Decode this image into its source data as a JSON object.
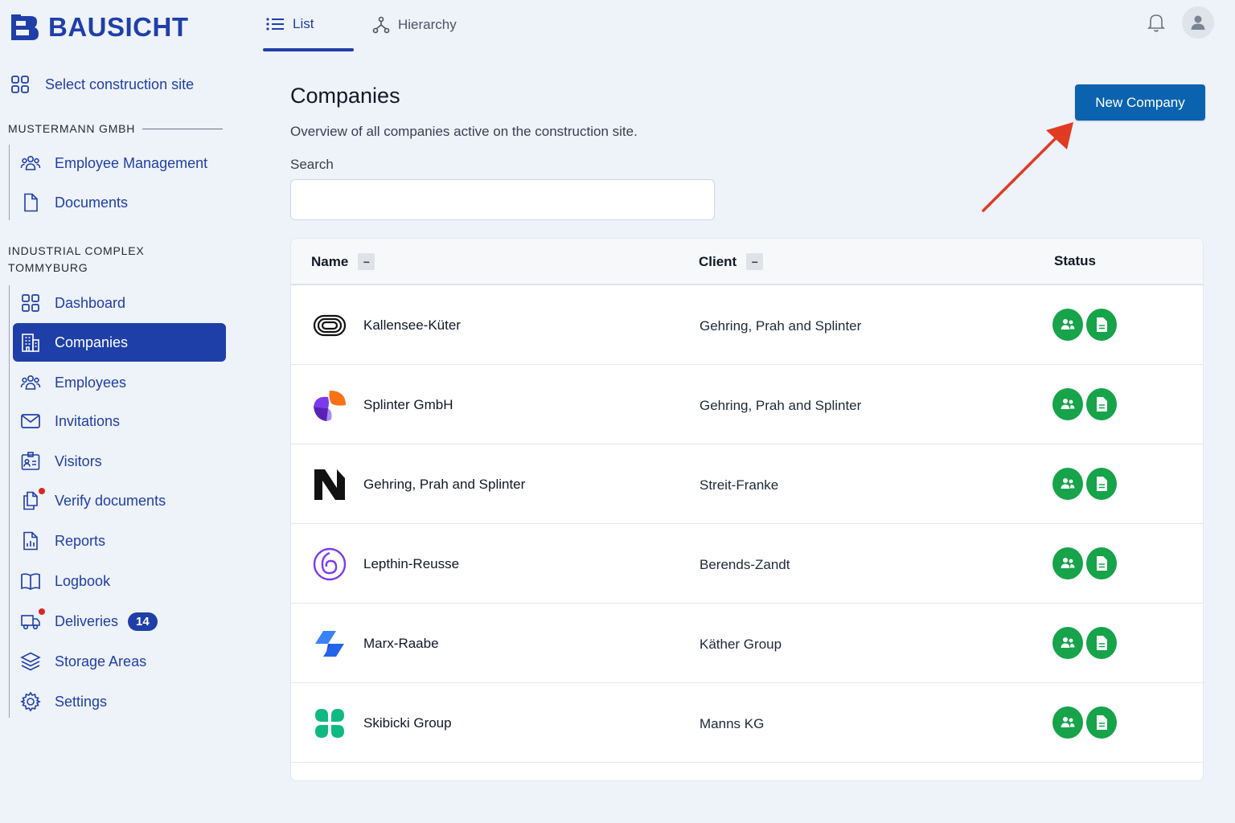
{
  "app": {
    "name": "BAUSICHT"
  },
  "tabs": [
    {
      "label": "List",
      "icon": "list-icon",
      "active": true
    },
    {
      "label": "Hierarchy",
      "icon": "hierarchy-icon",
      "active": false
    }
  ],
  "sidebar": {
    "select_site": "Select construction site",
    "org_section": "MUSTERMANN GMBH",
    "org_items": [
      {
        "label": "Employee Management",
        "icon": "users-icon"
      },
      {
        "label": "Documents",
        "icon": "document-icon"
      }
    ],
    "site_section_line1": "INDUSTRIAL COMPLEX",
    "site_section_line2": "TOMMYBURG",
    "site_items": [
      {
        "label": "Dashboard",
        "icon": "grid-icon"
      },
      {
        "label": "Companies",
        "icon": "building-icon",
        "active": true
      },
      {
        "label": "Employees",
        "icon": "users-icon"
      },
      {
        "label": "Invitations",
        "icon": "envelope-icon"
      },
      {
        "label": "Visitors",
        "icon": "visitor-card-icon"
      },
      {
        "label": "Verify documents",
        "icon": "documents-copy-icon",
        "alert": true
      },
      {
        "label": "Reports",
        "icon": "report-icon"
      },
      {
        "label": "Logbook",
        "icon": "book-icon"
      },
      {
        "label": "Deliveries",
        "icon": "truck-icon",
        "alert": true,
        "badge": "14"
      },
      {
        "label": "Storage Areas",
        "icon": "layers-icon"
      },
      {
        "label": "Settings",
        "icon": "gear-icon"
      }
    ]
  },
  "main": {
    "title": "Companies",
    "subtitle": "Overview of all companies active on the construction site.",
    "search_label": "Search",
    "search_value": "",
    "new_button": "New Company"
  },
  "table": {
    "headers": {
      "name": "Name",
      "client": "Client",
      "status": "Status"
    },
    "sort_symbol": "−",
    "rows": [
      {
        "name": "Kallensee-Küter",
        "client": "Gehring, Prah and Splinter",
        "logo": "rings-logo"
      },
      {
        "name": "Splinter GmbH",
        "client": "Gehring, Prah and Splinter",
        "logo": "petals-logo"
      },
      {
        "name": "Gehring, Prah and Splinter",
        "client": "Streit-Franke",
        "logo": "n-logo"
      },
      {
        "name": "Lepthin-Reusse",
        "client": "Berends-Zandt",
        "logo": "spiral-logo"
      },
      {
        "name": "Marx-Raabe",
        "client": "Käther Group",
        "logo": "slash-logo"
      },
      {
        "name": "Skibicki Group",
        "client": "Manns KG",
        "logo": "clover-logo"
      }
    ]
  },
  "colors": {
    "brand": "#1f3fa8",
    "button": "#0b63b0",
    "status_green": "#16a34a",
    "alert_red": "#dc2626",
    "arrow_red": "#e23a22"
  }
}
